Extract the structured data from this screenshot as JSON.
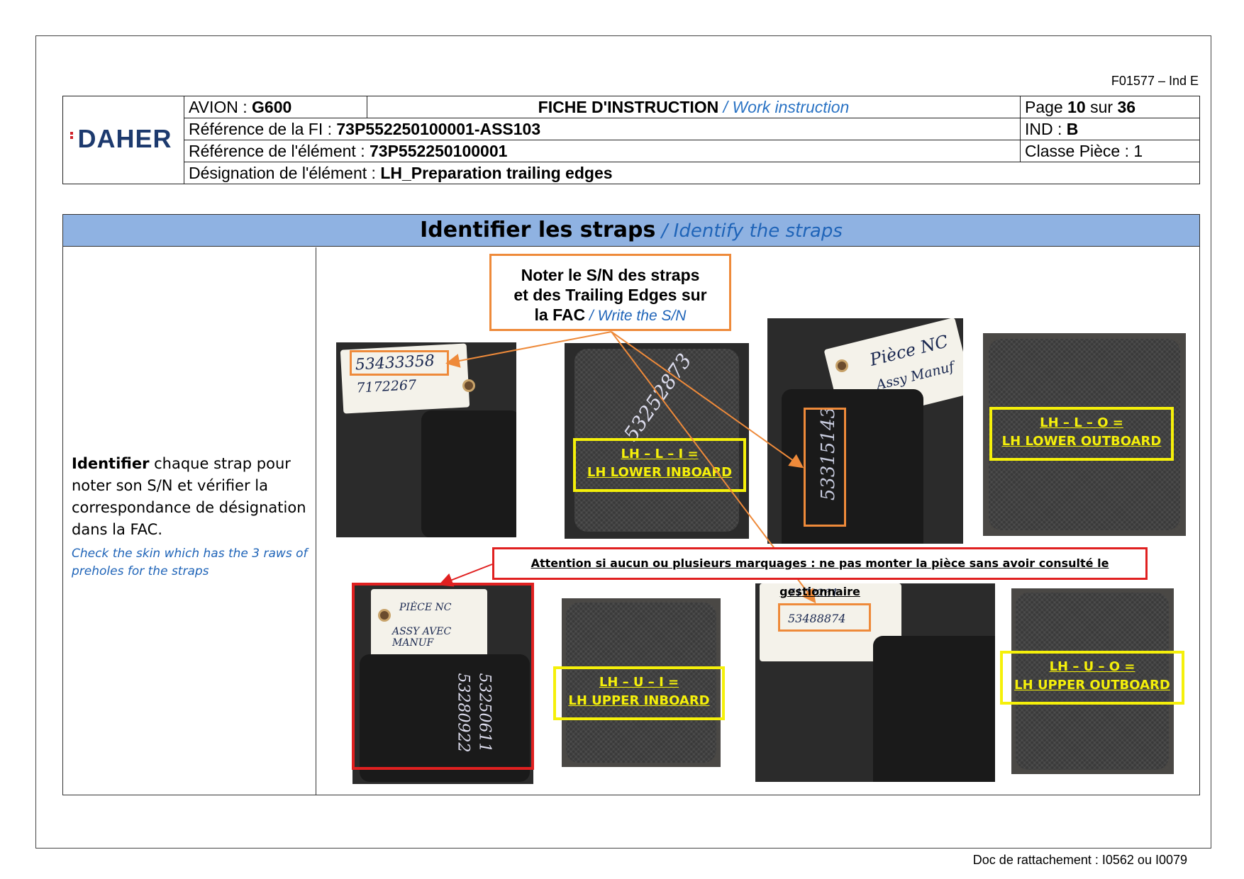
{
  "doc": {
    "form_code": "F01577 – Ind E",
    "footer": "Doc de rattachement : I0562 ou I0079"
  },
  "header": {
    "logo": "DAHER",
    "avion_label": "AVION : ",
    "avion_value": "G600",
    "fiche_label": "FICHE D'INSTRUCTION",
    "fiche_en": " / Work instruction",
    "page_label": "Page ",
    "page_num": "10",
    "page_sur": " sur ",
    "page_total": "36",
    "ref_fi_label": "Référence de la FI : ",
    "ref_fi_value": "73P552250100001-ASS103",
    "ind_label": "IND : ",
    "ind_value": "B",
    "ref_elem_label": "Référence de l'élément : ",
    "ref_elem_value": "73P552250100001",
    "classe": "Classe Pièce : 1",
    "desig_label": "Désignation de l'élément : ",
    "desig_value": "LH_Preparation trailing edges"
  },
  "section": {
    "title_fr": "Identifier les straps",
    "title_en": " / Identify the straps",
    "desc_bold": "Identifier",
    "desc_rest": " chaque strap pour noter son S/N et vérifier la correspondance de désignation dans la FAC.",
    "desc_en": "Check the skin which has the 3 raws of preholes for the straps"
  },
  "callouts": {
    "note_line1": "Noter le S/N des straps",
    "note_line2": "et des Trailing Edges sur",
    "note_line3": "la FAC",
    "note_en": " / Write the S/N",
    "warning": "Attention si aucun ou plusieurs marquages : ne pas monter la pièce sans avoir consulté le gestionnaire"
  },
  "labels": {
    "lli_1": "LH – L – I =",
    "lli_2": "LH LOWER INBOARD",
    "llo_1": "LH – L – O =",
    "llo_2": "LH LOWER OUTBOARD",
    "lui_1": "LH – U – I =",
    "lui_2": "LH UPPER INBOARD",
    "luo_1": "LH – U – O =",
    "luo_2": "LH UPPER OUTBOARD"
  },
  "handwriting": {
    "p1_sn": "53433358",
    "p1_line2": "7172267",
    "p2_sn": "53252873",
    "p3_tag1": "Pièce NC",
    "p3_tag2": "Assy Manuf",
    "p3_sn": "53315143",
    "p5_tag1": "PIÈCE NC",
    "p5_tag2": "ASSY AVEC MANUF",
    "p5_sn1": "53280922",
    "p5_sn2": "53250611",
    "p7_line1": "7172261",
    "p7_sn": "53488874"
  },
  "colors": {
    "section_bar": "#8fb2e2",
    "accent_blue": "#1f64b8",
    "callout_orange": "#ee8a3a",
    "warning_red": "#e02020",
    "label_yellow": "#f5f00a"
  }
}
